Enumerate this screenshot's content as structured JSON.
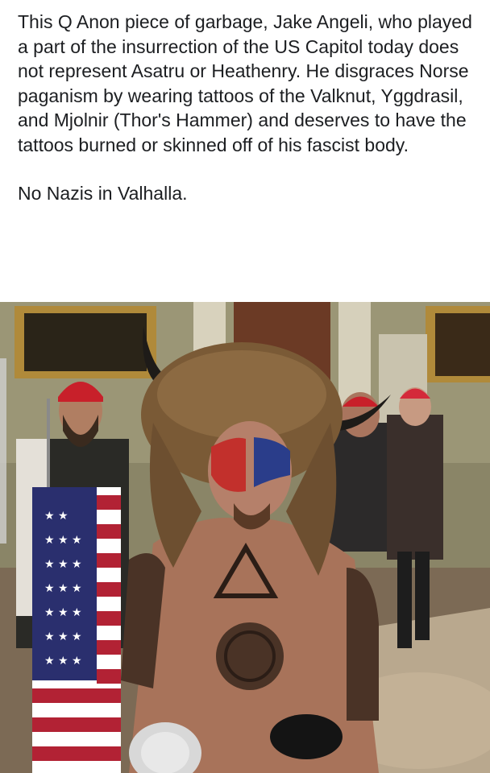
{
  "post": {
    "paragraphs": [
      "This Q Anon piece of garbage, Jake Angeli, who played a part of the insurrection of the US Capitol today does not represent Asatru or Heathenry. He disgraces Norse paganism by wearing tattoos of the Valknut, Yggdrasil, and Mjolnir (Thor's Hammer) and deserves to have the tattoos burned or skinned off of his fascist body.",
      "No Nazis in Valhalla."
    ]
  },
  "colors": {
    "text": "#1c1e21",
    "background": "#ffffff",
    "wall": "#8f8a6c",
    "fur_hat": "#7a5a36",
    "skin": "#a8735a",
    "flag_red": "#b22234",
    "flag_blue": "#2a2f6e"
  }
}
